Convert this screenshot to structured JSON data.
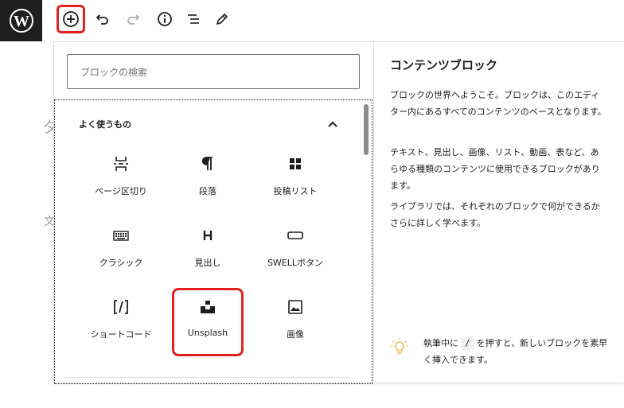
{
  "toolbar": {
    "logo": "wordpress-logo",
    "buttons": [
      "add-block",
      "undo",
      "redo",
      "details",
      "list-view",
      "tools"
    ]
  },
  "editor": {
    "bg_char_1": "タ",
    "bg_char_2": "文"
  },
  "inserter": {
    "search_placeholder": "ブロックの検索",
    "category_title": "よく使うもの",
    "blocks": [
      {
        "label": "ページ区切り",
        "icon": "page-break-icon"
      },
      {
        "label": "段落",
        "icon": "paragraph-icon"
      },
      {
        "label": "投稿リスト",
        "icon": "grid-icon"
      },
      {
        "label": "クラシック",
        "icon": "keyboard-icon"
      },
      {
        "label": "見出し",
        "icon": "heading-icon"
      },
      {
        "label": "SWELLボタン",
        "icon": "button-icon"
      },
      {
        "label": "ショートコード",
        "icon": "shortcode-icon"
      },
      {
        "label": "Unsplash",
        "icon": "unsplash-icon"
      },
      {
        "label": "画像",
        "icon": "image-icon"
      }
    ]
  },
  "info": {
    "title": "コンテンツブロック",
    "para1": "ブロックの世界へようこそ。ブロックは、このエディター内にあるすべてのコンテンツのベースとなります。",
    "para2": "テキスト、見出し、画像、リスト、動画、表など、あらゆる種類のコンテンツに使用できるブロックがあります。",
    "para3": "ライブラリでは、それぞれのブロックで何ができるかさらに詳しく学べます。",
    "tip_before": "執筆中に",
    "tip_key": "/",
    "tip_after": "を押すと、新しいブロックを素早く挿入できます。"
  },
  "colors": {
    "highlight": "#e0211d",
    "dark": "#1e1e1e",
    "tip_bulb": "#f0b849"
  }
}
